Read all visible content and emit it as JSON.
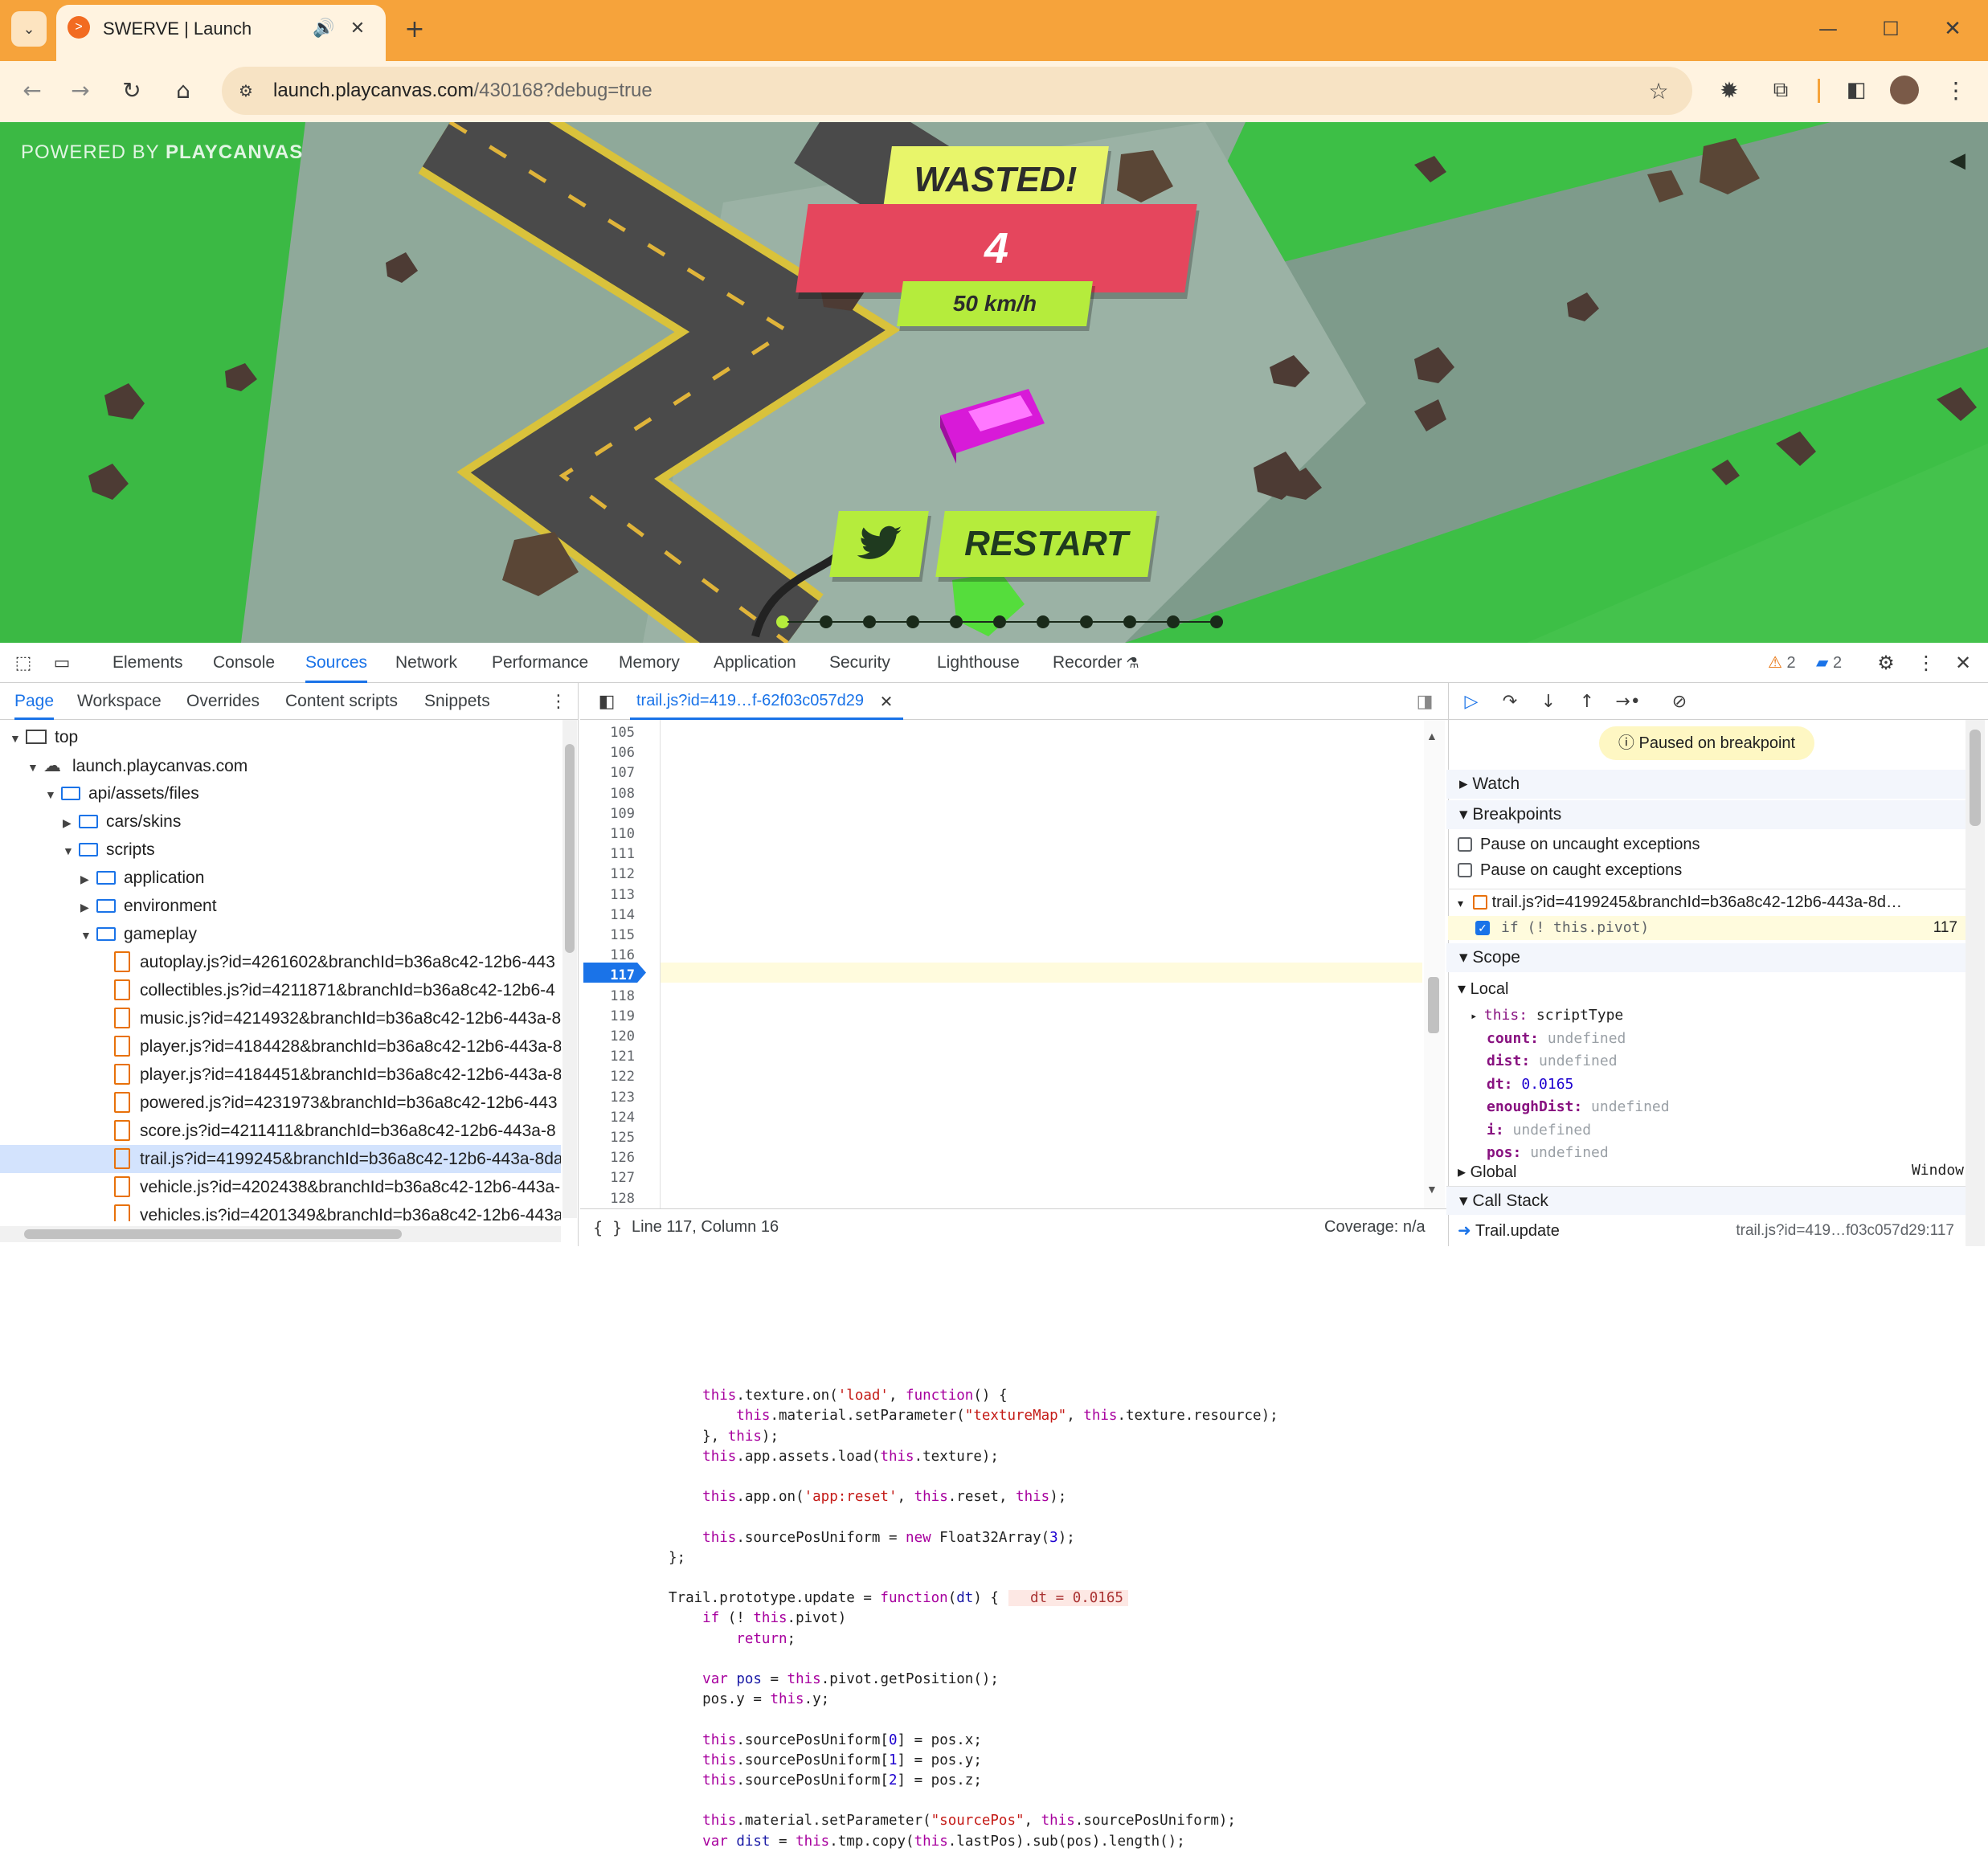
{
  "browser": {
    "tab_title": "SWERVE | Launch",
    "url_host": "launch.playcanvas.com",
    "url_path": "/430168?debug=true"
  },
  "game": {
    "powered_prefix": "POWERED BY ",
    "powered_brand": "PLAYCANVAS",
    "wasted": "WASTED!",
    "score": "4",
    "speed": "50 km/h",
    "restart": "RESTART",
    "page_dots": 11,
    "active_dot": 0
  },
  "devtools": {
    "tabs": [
      "Elements",
      "Console",
      "Sources",
      "Network",
      "Performance",
      "Memory",
      "Application",
      "Security",
      "Lighthouse",
      "Recorder"
    ],
    "active_tab": "Sources",
    "warnings": "2",
    "messages": "2",
    "nav_tabs": [
      "Page",
      "Workspace",
      "Overrides",
      "Content scripts",
      "Snippets"
    ],
    "tree": [
      {
        "label": "top",
        "depth": 0,
        "type": "frame",
        "open": true
      },
      {
        "label": "launch.playcanvas.com",
        "depth": 1,
        "type": "cloud",
        "open": true
      },
      {
        "label": "api/assets/files",
        "depth": 2,
        "type": "folder",
        "open": true
      },
      {
        "label": "cars/skins",
        "depth": 3,
        "type": "folder",
        "open": false
      },
      {
        "label": "scripts",
        "depth": 3,
        "type": "folder",
        "open": true
      },
      {
        "label": "application",
        "depth": 4,
        "type": "folder",
        "open": false
      },
      {
        "label": "environment",
        "depth": 4,
        "type": "folder",
        "open": false
      },
      {
        "label": "gameplay",
        "depth": 4,
        "type": "folder",
        "open": true
      },
      {
        "label": "autoplay.js?id=4261602&branchId=b36a8c42-12b6-443",
        "depth": 5,
        "type": "file"
      },
      {
        "label": "collectibles.js?id=4211871&branchId=b36a8c42-12b6-4",
        "depth": 5,
        "type": "file"
      },
      {
        "label": "music.js?id=4214932&branchId=b36a8c42-12b6-443a-8",
        "depth": 5,
        "type": "file"
      },
      {
        "label": "player.js?id=4184428&branchId=b36a8c42-12b6-443a-8",
        "depth": 5,
        "type": "file"
      },
      {
        "label": "player.js?id=4184451&branchId=b36a8c42-12b6-443a-8",
        "depth": 5,
        "type": "file"
      },
      {
        "label": "powered.js?id=4231973&branchId=b36a8c42-12b6-443",
        "depth": 5,
        "type": "file"
      },
      {
        "label": "score.js?id=4211411&branchId=b36a8c42-12b6-443a-8",
        "depth": 5,
        "type": "file"
      },
      {
        "label": "trail.js?id=4199245&branchId=b36a8c42-12b6-443a-8da",
        "depth": 5,
        "type": "file",
        "selected": true
      },
      {
        "label": "vehicle.js?id=4202438&branchId=b36a8c42-12b6-443a-",
        "depth": 5,
        "type": "file"
      },
      {
        "label": "vehicles.js?id=4201349&branchId=b36a8c42-12b6-443a",
        "depth": 5,
        "type": "file"
      }
    ],
    "editor_tab": "trail.js?id=419…f-62f03c057d29",
    "lines": [
      "105",
      "106",
      "107",
      "108",
      "109",
      "110",
      "111",
      "112",
      "113",
      "114",
      "115",
      "116",
      "117",
      "118",
      "119",
      "120",
      "121",
      "122",
      "123",
      "124",
      "125",
      "126",
      "127",
      "128"
    ],
    "status_position": "Line 117, Column 16",
    "coverage": "Coverage: n/a",
    "paused": "Paused on breakpoint",
    "sections": {
      "watch": "Watch",
      "breakpoints": "Breakpoints",
      "scope": "Scope",
      "local": "Local",
      "global": "Global",
      "global_value": "Window",
      "call_stack": "Call Stack"
    },
    "pause_uncaught": "Pause on uncaught exceptions",
    "pause_caught": "Pause on caught exceptions",
    "bp_file": "trail.js?id=4199245&branchId=b36a8c42-12b6-443a-8d…",
    "bp_code": "if (! this.pivot)",
    "bp_line": "117",
    "scope": [
      {
        "k": "this",
        "v": "scriptType",
        "cls": "plain"
      },
      {
        "k": "count",
        "v": "undefined",
        "cls": "undef"
      },
      {
        "k": "dist",
        "v": "undefined",
        "cls": "undef"
      },
      {
        "k": "dt",
        "v": "0.0165",
        "cls": "num"
      },
      {
        "k": "enoughDist",
        "v": "undefined",
        "cls": "undef"
      },
      {
        "k": "i",
        "v": "undefined",
        "cls": "undef"
      },
      {
        "k": "pos",
        "v": "undefined",
        "cls": "undef"
      }
    ],
    "call_frame": "Trail.update",
    "call_loc": "trail.js?id=419…f03c057d29:117"
  }
}
